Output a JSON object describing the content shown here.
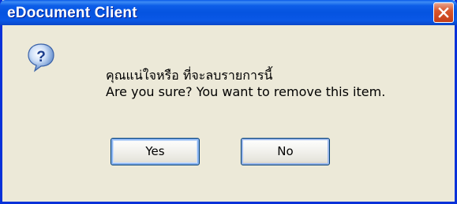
{
  "dialog": {
    "title": "eDocument Client",
    "icon": "question-icon",
    "message_line1": "คุณแน่ใจหรือ ที่จะลบรายการนี้",
    "message_line2": "Are you sure? You want to remove this item.",
    "buttons": {
      "yes_label": "Yes",
      "no_label": "No"
    }
  },
  "colors": {
    "titlebar": "#0553e0",
    "frame": "#0831d9",
    "background": "#ece9d8",
    "close_button": "#d8562c"
  }
}
